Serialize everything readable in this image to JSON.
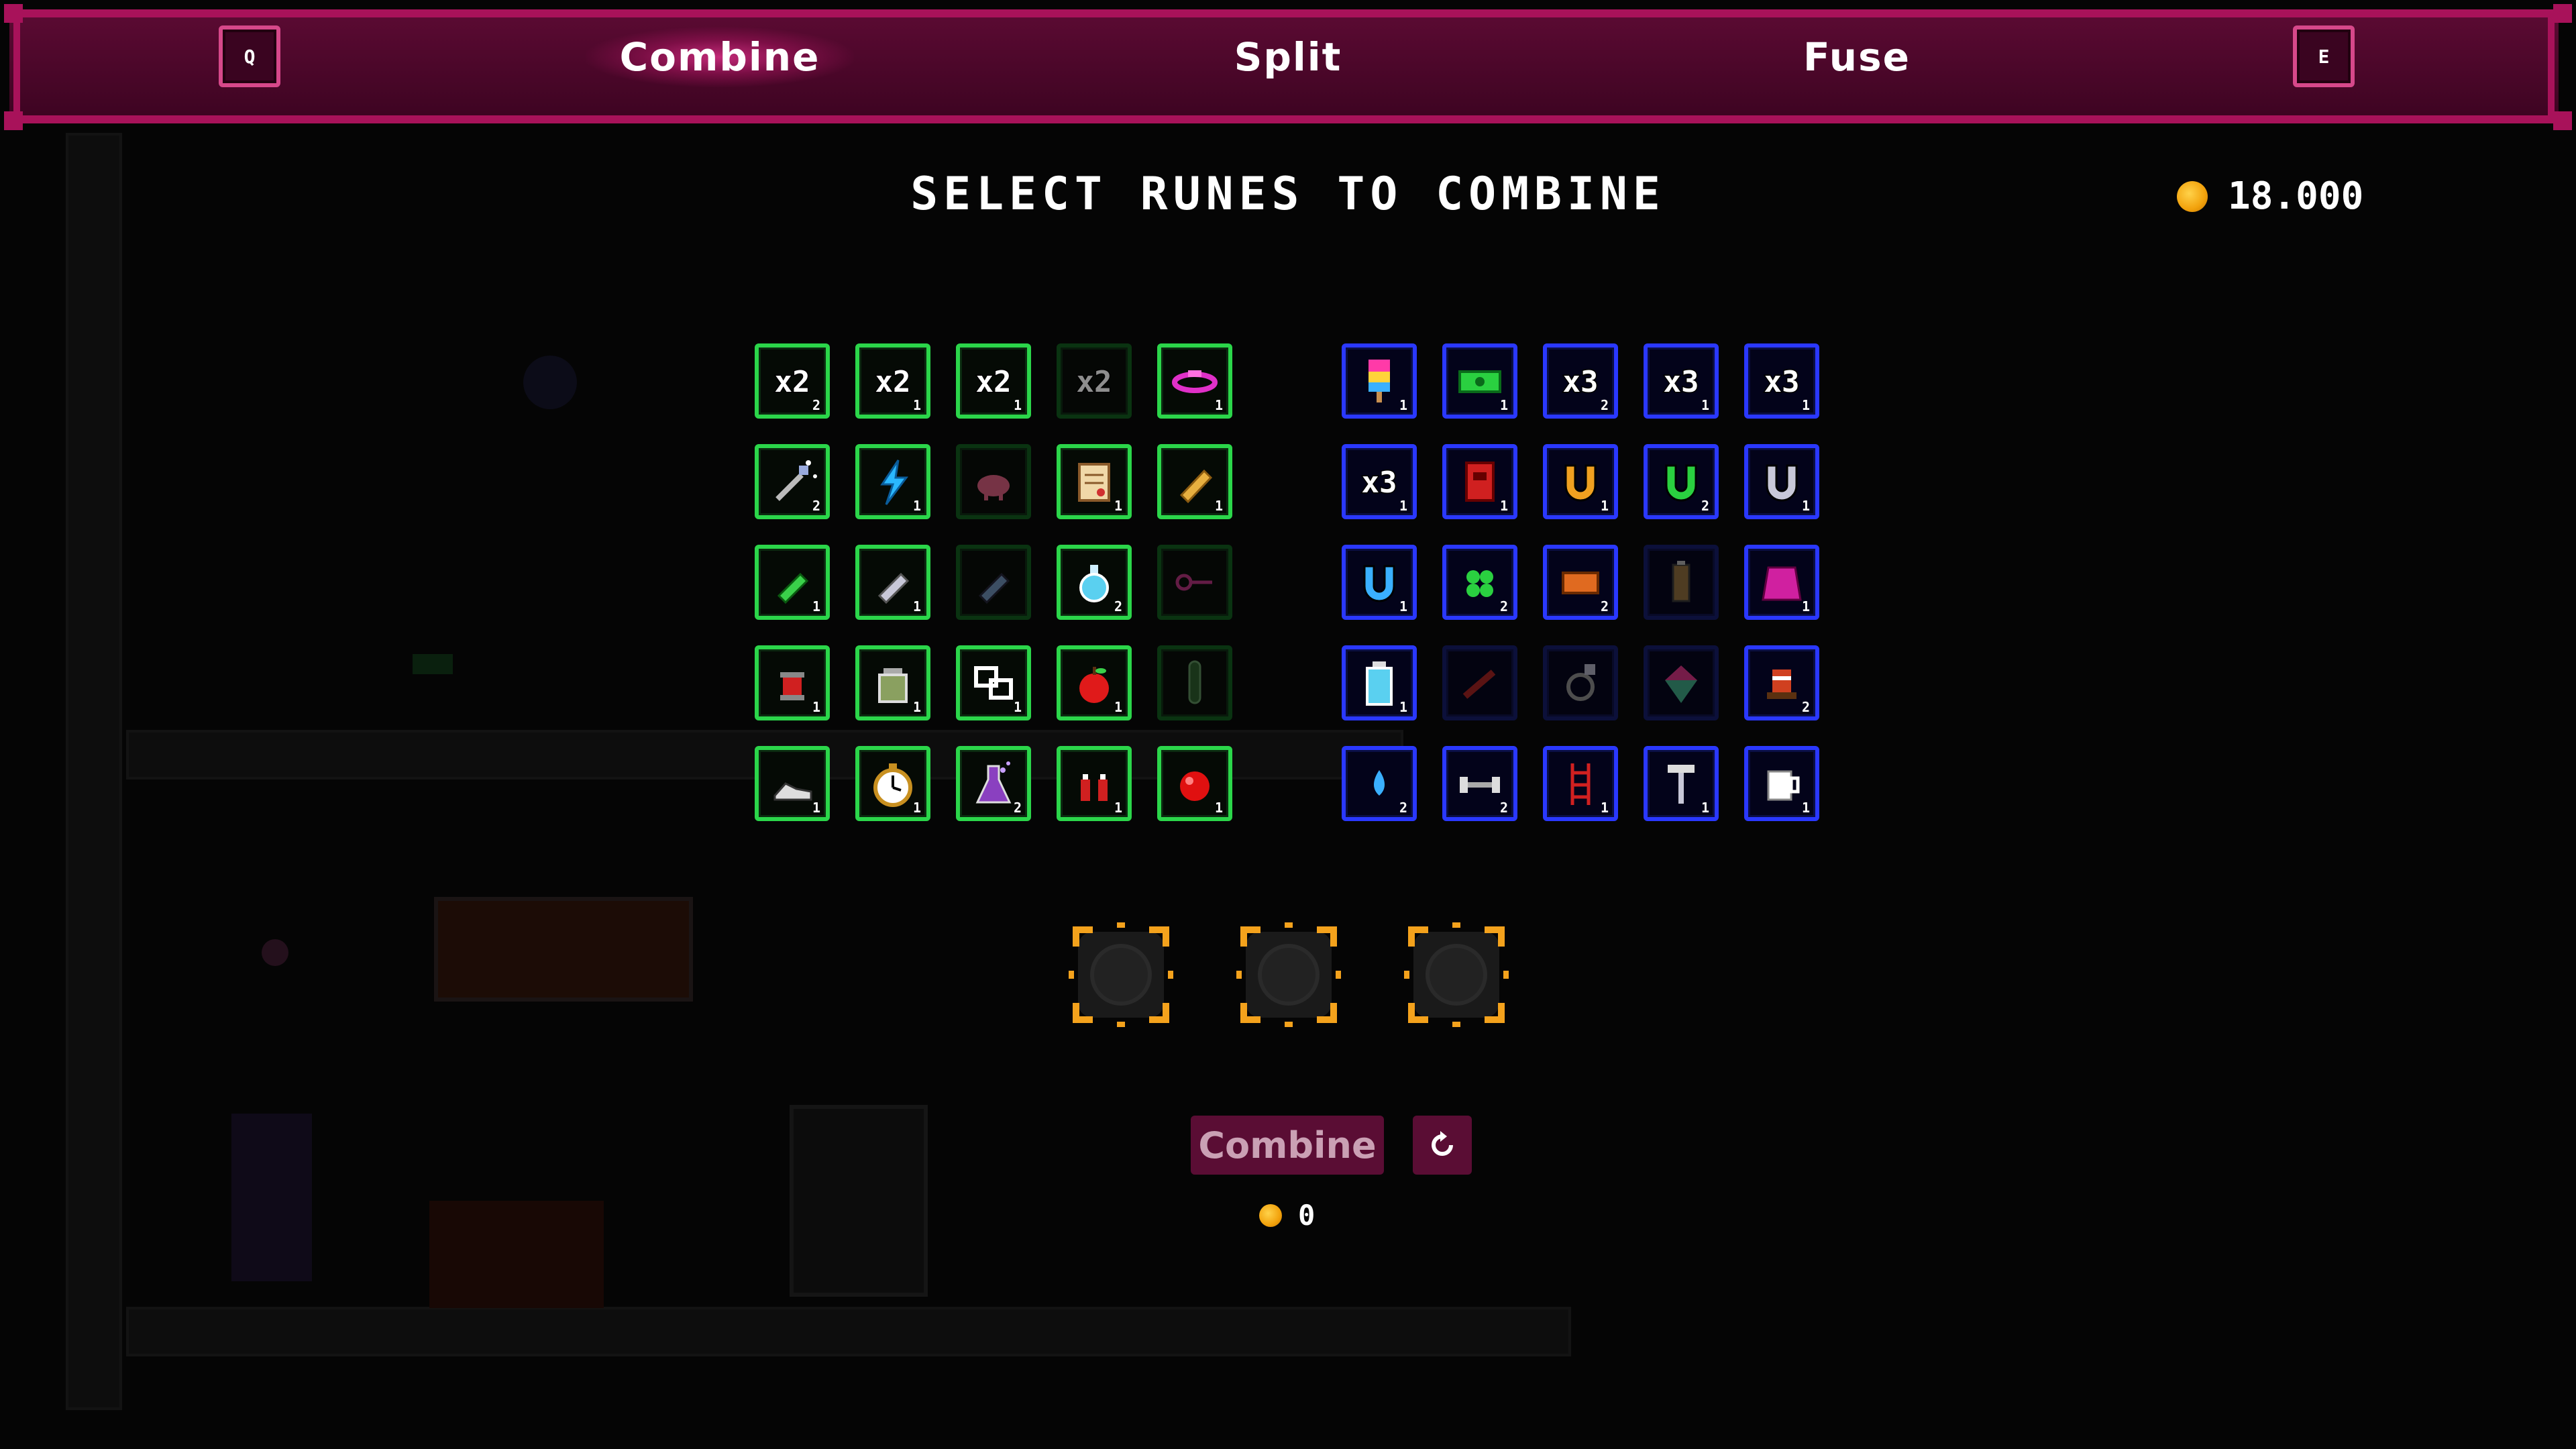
{
  "tabs": {
    "prev_key": "Q",
    "next_key": "E",
    "items": [
      "Combine",
      "Split",
      "Fuse"
    ],
    "active": "Combine"
  },
  "title": "SELECT RUNES TO COMBINE",
  "gold": "18.000",
  "cost": "0",
  "combine_button": "Combine",
  "colors": {
    "accent": "#a8125a",
    "common_border": "#2bd64a",
    "rare_border": "#2a38ff",
    "socket_corner": "#f4a21c",
    "coin": "#f2a20c"
  },
  "common_runes": [
    {
      "icon": "x2-multiplier-icon",
      "count": "2"
    },
    {
      "icon": "x2-multiplier-icon",
      "count": "1"
    },
    {
      "icon": "x2-multiplier-icon",
      "count": "1"
    },
    {
      "icon": "x2-multiplier-icon",
      "count": "",
      "dim": true
    },
    {
      "icon": "pink-ring-icon",
      "count": "1"
    },
    {
      "icon": "magic-wand-icon",
      "count": "2"
    },
    {
      "icon": "lightning-bolt-icon",
      "count": "1"
    },
    {
      "icon": "piggy-bank-icon",
      "count": "",
      "dim": true
    },
    {
      "icon": "scroll-icon",
      "count": "1"
    },
    {
      "icon": "bread-icon",
      "count": "1"
    },
    {
      "icon": "green-pill-icon",
      "count": "1"
    },
    {
      "icon": "silver-pill-icon",
      "count": "1"
    },
    {
      "icon": "blue-pill-icon",
      "count": "",
      "dim": true
    },
    {
      "icon": "potion-flask-icon",
      "count": "2"
    },
    {
      "icon": "pink-key-icon",
      "count": "",
      "dim": true
    },
    {
      "icon": "red-spool-icon",
      "count": "1"
    },
    {
      "icon": "jar-icon",
      "count": "1"
    },
    {
      "icon": "chain-link-icon",
      "count": "1"
    },
    {
      "icon": "apple-icon",
      "count": "1"
    },
    {
      "icon": "test-tube-icon",
      "count": "",
      "dim": true
    },
    {
      "icon": "sneaker-icon",
      "count": "1"
    },
    {
      "icon": "stopwatch-icon",
      "count": "1"
    },
    {
      "icon": "bubbling-flask-icon",
      "count": "2"
    },
    {
      "icon": "red-bottles-icon",
      "count": "1"
    },
    {
      "icon": "red-orb-icon",
      "count": "1"
    }
  ],
  "rare_runes": [
    {
      "icon": "popsicle-icon",
      "count": "1"
    },
    {
      "icon": "green-banknote-icon",
      "count": "1"
    },
    {
      "icon": "x3-multiplier-icon",
      "count": "2"
    },
    {
      "icon": "x3-multiplier-icon",
      "count": "1"
    },
    {
      "icon": "x3-multiplier-icon",
      "count": "1"
    },
    {
      "icon": "x3-multiplier-icon",
      "count": "1"
    },
    {
      "icon": "red-book-icon",
      "count": "1"
    },
    {
      "icon": "orange-magnet-icon",
      "count": "1"
    },
    {
      "icon": "green-magnet-icon",
      "count": "2"
    },
    {
      "icon": "silver-magnet-icon",
      "count": "1"
    },
    {
      "icon": "blue-magnet-icon",
      "count": "1"
    },
    {
      "icon": "clover-icon",
      "count": "2"
    },
    {
      "icon": "orange-ticket-icon",
      "count": "2"
    },
    {
      "icon": "battery-icon",
      "count": "",
      "dim": true
    },
    {
      "icon": "pink-cape-icon",
      "count": "1"
    },
    {
      "icon": "water-bottle-icon",
      "count": "1"
    },
    {
      "icon": "red-wrench-icon",
      "count": "",
      "dim": true
    },
    {
      "icon": "gem-ring-icon",
      "count": "",
      "dim": true
    },
    {
      "icon": "spinning-top-icon",
      "count": "",
      "dim": true
    },
    {
      "icon": "striped-hat-icon",
      "count": "2"
    },
    {
      "icon": "water-drop-icon",
      "count": "2"
    },
    {
      "icon": "dumbbell-icon",
      "count": "2"
    },
    {
      "icon": "red-ladder-icon",
      "count": "1"
    },
    {
      "icon": "hammer-icon",
      "count": "1"
    },
    {
      "icon": "coffee-mug-icon",
      "count": "1"
    }
  ],
  "sockets": [
    "empty",
    "empty",
    "empty"
  ]
}
